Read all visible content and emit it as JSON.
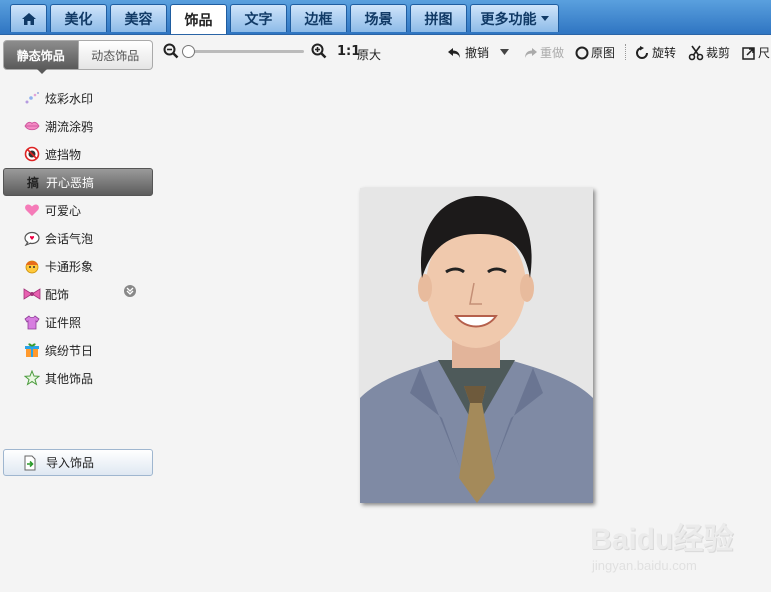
{
  "tabs": [
    {
      "label": ""
    },
    {
      "label": "美化"
    },
    {
      "label": "美容"
    },
    {
      "label": "饰品"
    },
    {
      "label": "文字"
    },
    {
      "label": "边框"
    },
    {
      "label": "场景"
    },
    {
      "label": "拼图"
    },
    {
      "label": "更多功能"
    }
  ],
  "active_tab": "饰品",
  "toolbar": {
    "zoom_ratio": "1:1",
    "orig_size_label": "原大",
    "undo_label": "撤销",
    "redo_label": "重做",
    "original_label": "原图",
    "rotate_label": "旋转",
    "crop_label": "裁剪",
    "size_label": "尺"
  },
  "sidebar": {
    "seg_static": "静态饰品",
    "seg_dynamic": "动态饰品",
    "items": [
      {
        "label": "炫彩水印",
        "icon": "sparkle-icon"
      },
      {
        "label": "潮流涂鸦",
        "icon": "lips-icon"
      },
      {
        "label": "遮挡物",
        "icon": "mask-icon"
      },
      {
        "label": "开心恶搞",
        "icon": "gao-icon",
        "badge": "搞"
      },
      {
        "label": "可爱心",
        "icon": "heart-icon"
      },
      {
        "label": "会话气泡",
        "icon": "speech-bubble-icon"
      },
      {
        "label": "卡通形象",
        "icon": "cartoon-face-icon"
      },
      {
        "label": "配饰",
        "icon": "bow-icon"
      },
      {
        "label": "证件照",
        "icon": "shirt-icon"
      },
      {
        "label": "缤纷节日",
        "icon": "gift-icon"
      },
      {
        "label": "其他饰品",
        "icon": "star-icon"
      }
    ],
    "import_label": "导入饰品"
  },
  "watermark": {
    "logo": "Baidu经验",
    "url": "jingyan.baidu.com"
  },
  "colors": {
    "topbar": "#3d86d0",
    "selected_item": "#6b6b6b",
    "canvas": "#f4f4f4"
  }
}
